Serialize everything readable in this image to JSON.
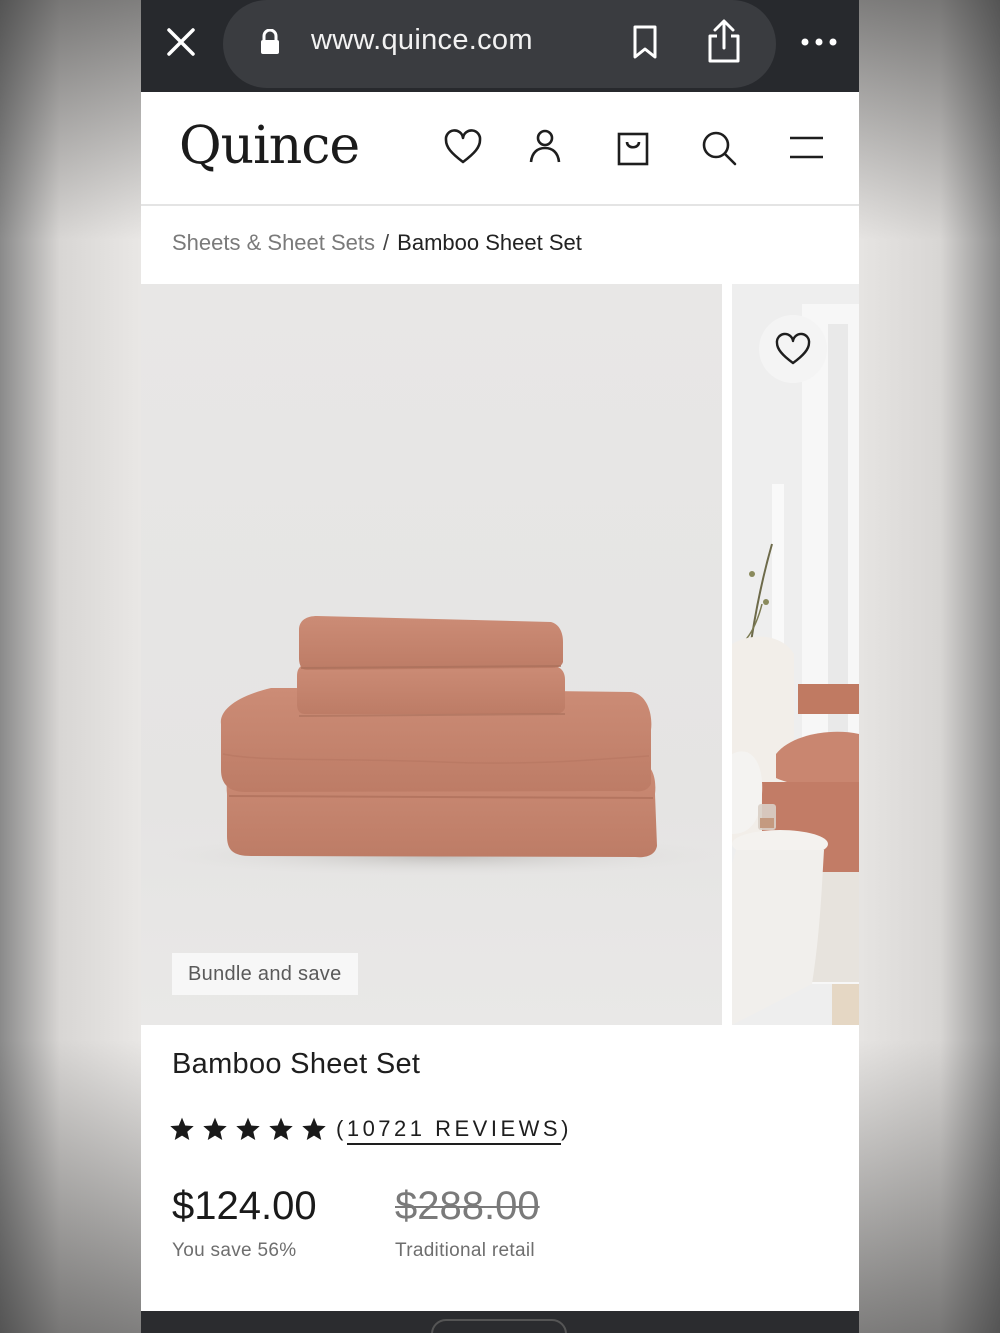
{
  "browser": {
    "url": "www.quince.com",
    "icons": [
      "close-icon",
      "lock-icon",
      "bookmark-icon",
      "share-icon",
      "more-icon"
    ]
  },
  "header": {
    "logo": "Quince",
    "icons": [
      "heart-icon",
      "account-icon",
      "cart-icon",
      "search-icon",
      "menu-icon"
    ]
  },
  "breadcrumb": {
    "parent": "Sheets & Sheet Sets",
    "separator": "/",
    "current": "Bamboo Sheet Set"
  },
  "gallery": {
    "badge": "Bundle and save"
  },
  "product": {
    "title": "Bamboo Sheet Set",
    "rating_stars": 5,
    "reviews_open": "(",
    "reviews_text": "10721 REVIEWS",
    "reviews_close": ")",
    "price": "$124.00",
    "savings": "You save 56%",
    "retail_price": "$288.00",
    "retail_label": "Traditional retail"
  },
  "colors": {
    "browser_bar": "#27292d",
    "sheet_color": "#c78670",
    "text_dark": "#1e1e1e"
  }
}
